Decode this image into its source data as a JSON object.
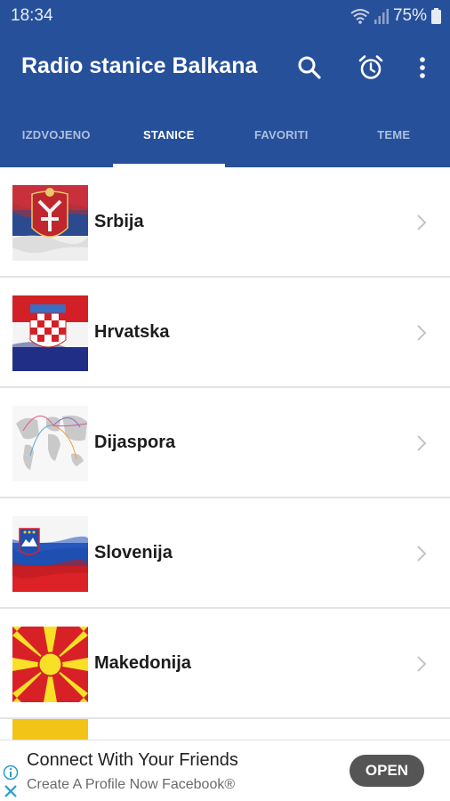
{
  "status_bar": {
    "time": "18:34",
    "battery": "75%"
  },
  "app_bar": {
    "title": "Radio stanice Balkana",
    "actions": [
      "search-icon",
      "alarm-icon",
      "more-vert-icon"
    ],
    "color": "#26509a"
  },
  "tabs": [
    {
      "label": "IZDVOJENO",
      "active": false
    },
    {
      "label": "STANICE",
      "active": true
    },
    {
      "label": "FAVORITI",
      "active": false
    },
    {
      "label": "TEME",
      "active": false
    }
  ],
  "stations": [
    {
      "name": "Srbija",
      "flag": "serbia-flag"
    },
    {
      "name": "Hrvatska",
      "flag": "croatia-flag"
    },
    {
      "name": "Dijaspora",
      "flag": "world-map"
    },
    {
      "name": "Slovenija",
      "flag": "slovenia-flag"
    },
    {
      "name": "Makedonija",
      "flag": "macedonia-flag"
    }
  ],
  "ad": {
    "title": "Connect With Your Friends",
    "subtitle": "Create A Profile Now Facebook®",
    "button": "OPEN"
  }
}
